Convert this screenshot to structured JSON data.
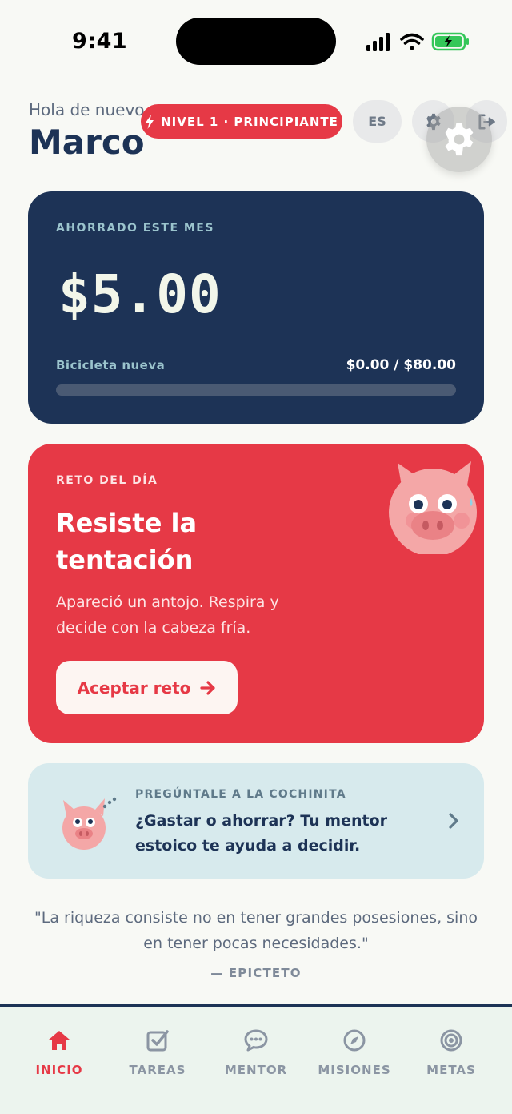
{
  "status_bar": {
    "time": "9:41"
  },
  "header": {
    "greeting": "Hola de nuevo",
    "user_name": "Marco",
    "level_badge": "NIVEL 1 · PRINCIPIANTE",
    "language": "ES"
  },
  "savings": {
    "label": "AHORRADO ESTE MES",
    "amount": "$5.00",
    "goal_name": "Bicicleta nueva",
    "goal_progress": "$0.00 / $80.00",
    "progress_fraction": 0
  },
  "challenge": {
    "label": "RETO DEL DÍA",
    "title": "Resiste la tentación",
    "description": "Apareció un antojo. Respira y decide con la cabeza fría.",
    "button_label": "Aceptar reto"
  },
  "mentor": {
    "label": "PREGÚNTALE A LA COCHINITA",
    "text": "¿Gastar o ahorrar? Tu mentor estoico te ayuda a decidir."
  },
  "quote": {
    "text": "\"La riqueza consiste no en tener grandes posesiones, sino en tener pocas necesidades.\"",
    "author": "— EPICTETO"
  },
  "nav": {
    "items": [
      {
        "label": "INICIO",
        "icon": "home-icon",
        "active": true
      },
      {
        "label": "TAREAS",
        "icon": "checkbox-icon",
        "active": false
      },
      {
        "label": "MENTOR",
        "icon": "chat-bubble-icon",
        "active": false
      },
      {
        "label": "MISIONES",
        "icon": "compass-icon",
        "active": false
      },
      {
        "label": "METAS",
        "icon": "target-icon",
        "active": false
      }
    ]
  },
  "colors": {
    "navy": "#1d3356",
    "red": "#e63946",
    "light_blue": "#d7eaed",
    "accent_teal": "#9bc4cd",
    "background": "#f8f9f5"
  }
}
